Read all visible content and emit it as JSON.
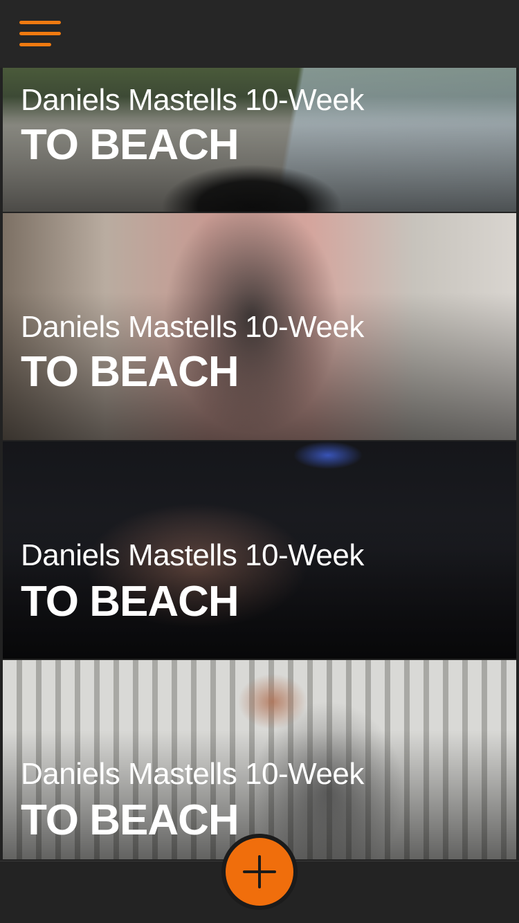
{
  "header": {
    "menu_icon": "hamburger-menu-icon",
    "accent_color": "#f07a10"
  },
  "cards": [
    {
      "subtitle": "Daniels Mastells 10-Week",
      "title": "TO BEACH"
    },
    {
      "subtitle": "Daniels Mastells 10-Week",
      "title": "TO BEACH"
    },
    {
      "subtitle": "Daniels Mastells 10-Week",
      "title": "TO BEACH"
    },
    {
      "subtitle": "Daniels Mastells 10-Week",
      "title": "TO BEACH"
    }
  ],
  "fab": {
    "icon": "plus-icon",
    "color": "#f06e0c"
  }
}
